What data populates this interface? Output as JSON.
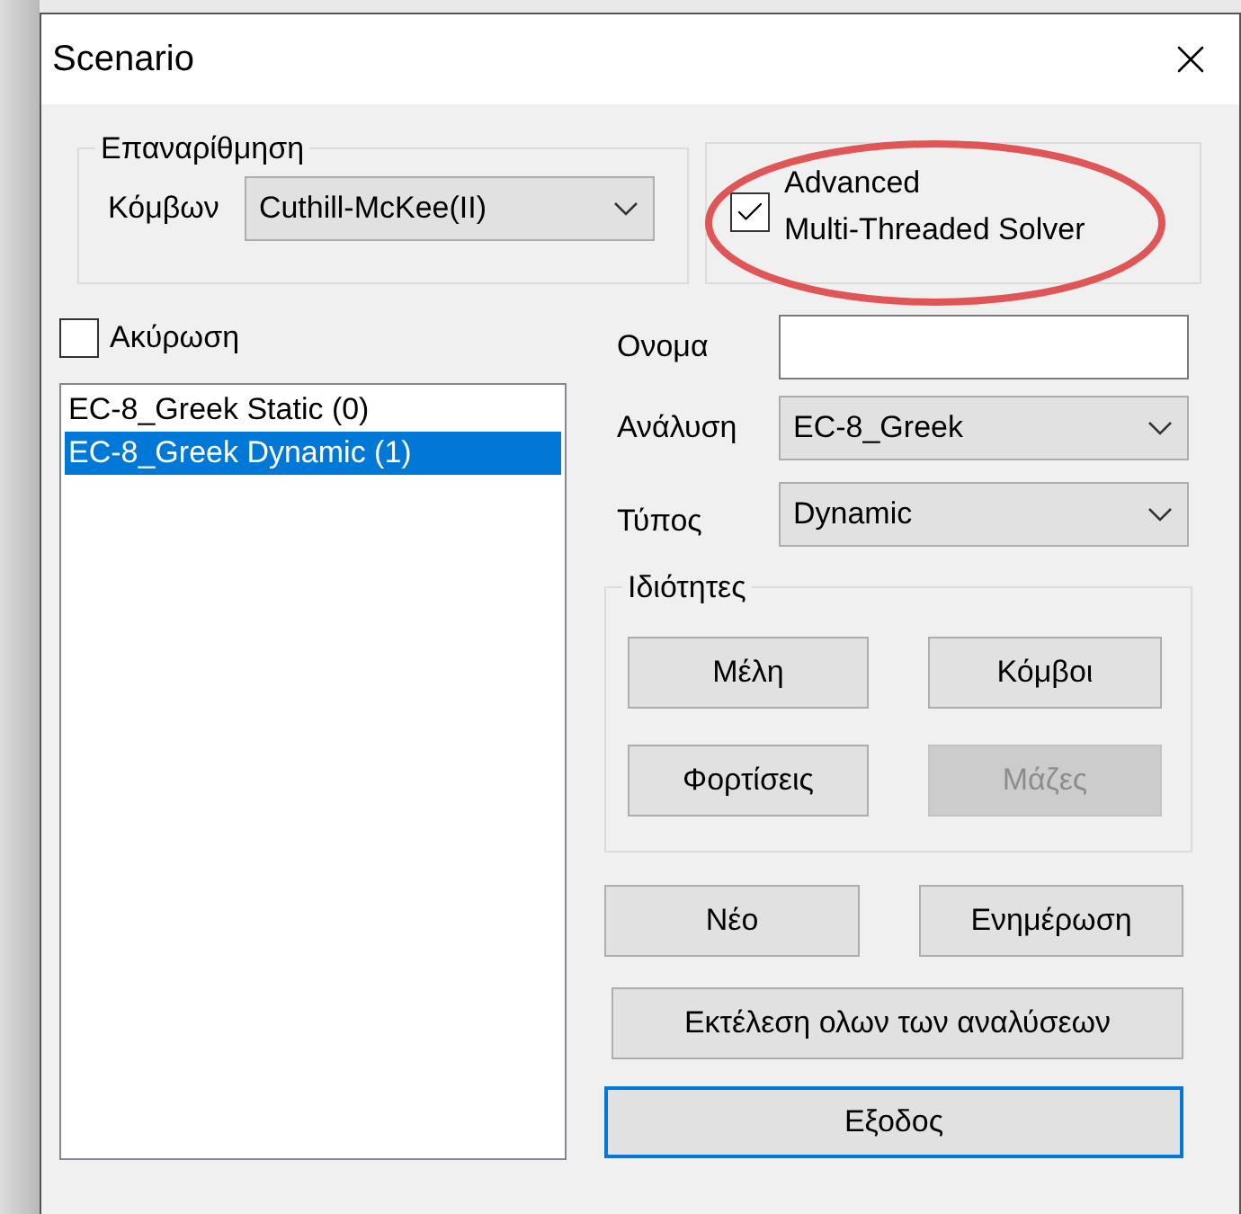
{
  "window": {
    "title": "Scenario"
  },
  "renumbering": {
    "legend": "Επαναρίθμηση",
    "label": "Κόμβων",
    "value": "Cuthill-McKee(II)"
  },
  "solver": {
    "label": "Advanced\nMulti-Threaded Solver",
    "checked": true
  },
  "cancel": {
    "label": "Ακύρωση",
    "checked": false
  },
  "scenarios": [
    {
      "label": "EC-8_Greek Static (0)",
      "selected": false
    },
    {
      "label": "EC-8_Greek Dynamic (1)",
      "selected": true
    }
  ],
  "name_field": {
    "label": "Ονομα"
  },
  "analysis": {
    "label": "Ανάλυση",
    "value": "EC-8_Greek"
  },
  "type": {
    "label": "Τύπος",
    "value": "Dynamic"
  },
  "properties": {
    "legend": "Ιδιότητες",
    "buttons": [
      {
        "label": "Μέλη",
        "disabled": false
      },
      {
        "label": "Κόμβοι",
        "disabled": false
      },
      {
        "label": "Φορτίσεις",
        "disabled": false
      },
      {
        "label": "Μάζες",
        "disabled": true
      }
    ]
  },
  "actions": [
    {
      "label": "Νέο",
      "focused": false
    },
    {
      "label": "Ενημέρωση",
      "focused": false
    }
  ],
  "run_all": {
    "label": "Εκτέλεση ολων των αναλύσεων",
    "focused": false
  },
  "exit": {
    "label": "Εξοδος",
    "focused": true
  }
}
